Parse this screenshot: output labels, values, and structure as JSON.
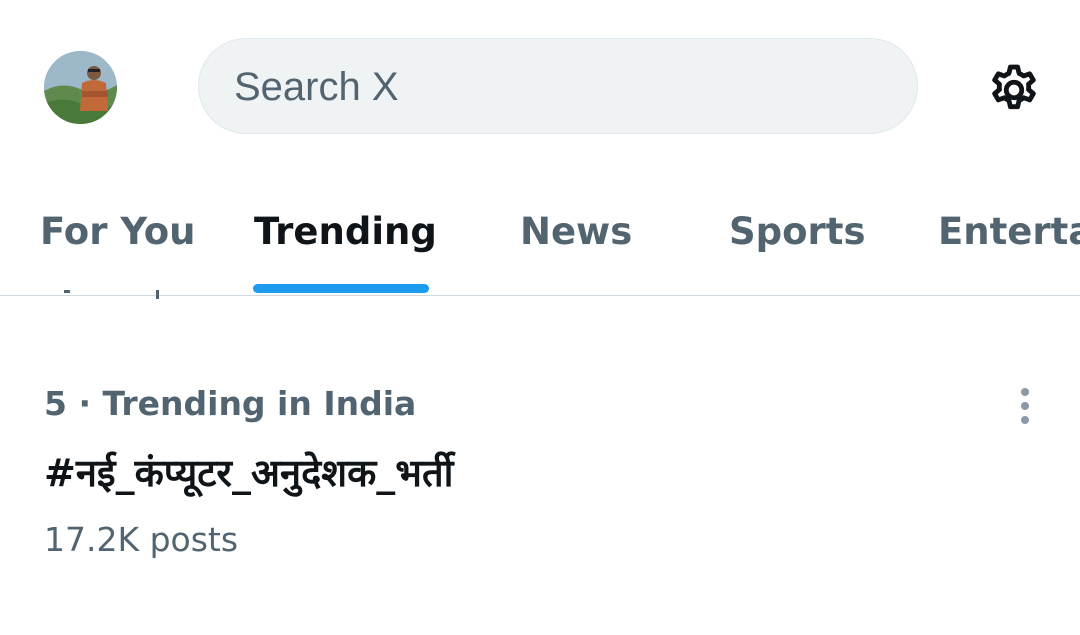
{
  "header": {
    "avatar_icon": "profile-avatar",
    "search": {
      "placeholder": "Search X",
      "value": ""
    },
    "settings_icon": "gear-icon"
  },
  "tabs": [
    {
      "label": "For You",
      "active": false
    },
    {
      "label": "Trending",
      "active": true
    },
    {
      "label": "News",
      "active": false
    },
    {
      "label": "Sports",
      "active": false
    },
    {
      "label": "Enterta",
      "active": false
    }
  ],
  "trend": {
    "meta": "5 · Trending in India",
    "name": "#नई_कंप्यूटर_अनुदेशक_भर्ती",
    "posts": "17.2K posts",
    "more_icon": "more-vertical-icon"
  },
  "colors": {
    "accent": "#1d9bf0",
    "primary_text": "#0f1419",
    "secondary_text": "#536471",
    "search_bg": "#eff3f4",
    "divider": "#cfd9de"
  }
}
